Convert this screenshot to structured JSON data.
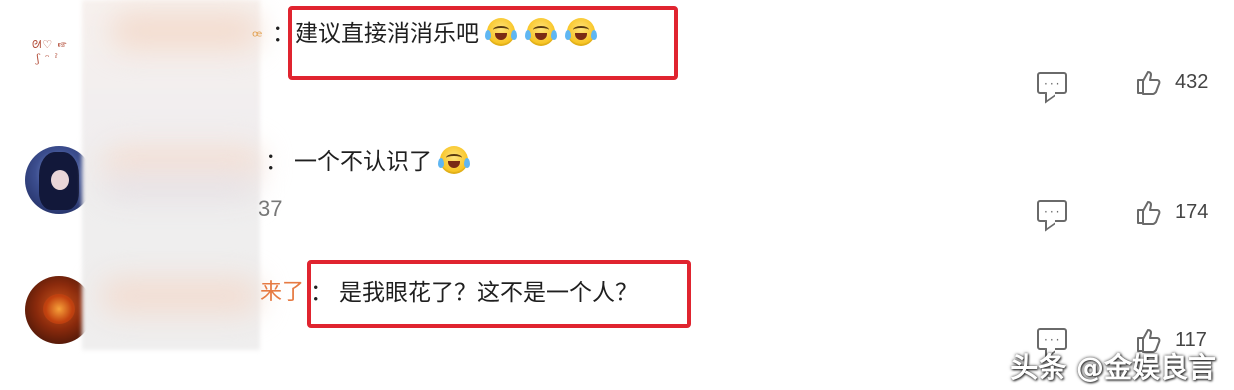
{
  "comments": [
    {
      "name_visible": "",
      "colon": "：",
      "text": "建议直接消消乐吧",
      "emoji": [
        "crying-laughing-emoji",
        "crying-laughing-emoji",
        "crying-laughing-emoji"
      ],
      "likes": "432",
      "highlighted": true
    },
    {
      "name_visible": "",
      "colon": "：",
      "text": "一个不认识了",
      "emoji": [
        "crying-laughing-emoji"
      ],
      "extra": "37",
      "likes": "174",
      "highlighted": false
    },
    {
      "name_visible": "来了",
      "colon": "：",
      "text": "是我眼花了？这不是一个人？",
      "emoji": [],
      "likes": "117",
      "highlighted": true
    }
  ],
  "watermark": "头条 @金娱良言",
  "colors": {
    "highlight": "#e0242f",
    "name_orange": "#e67a42",
    "icon_gray": "#6a6a6a"
  }
}
